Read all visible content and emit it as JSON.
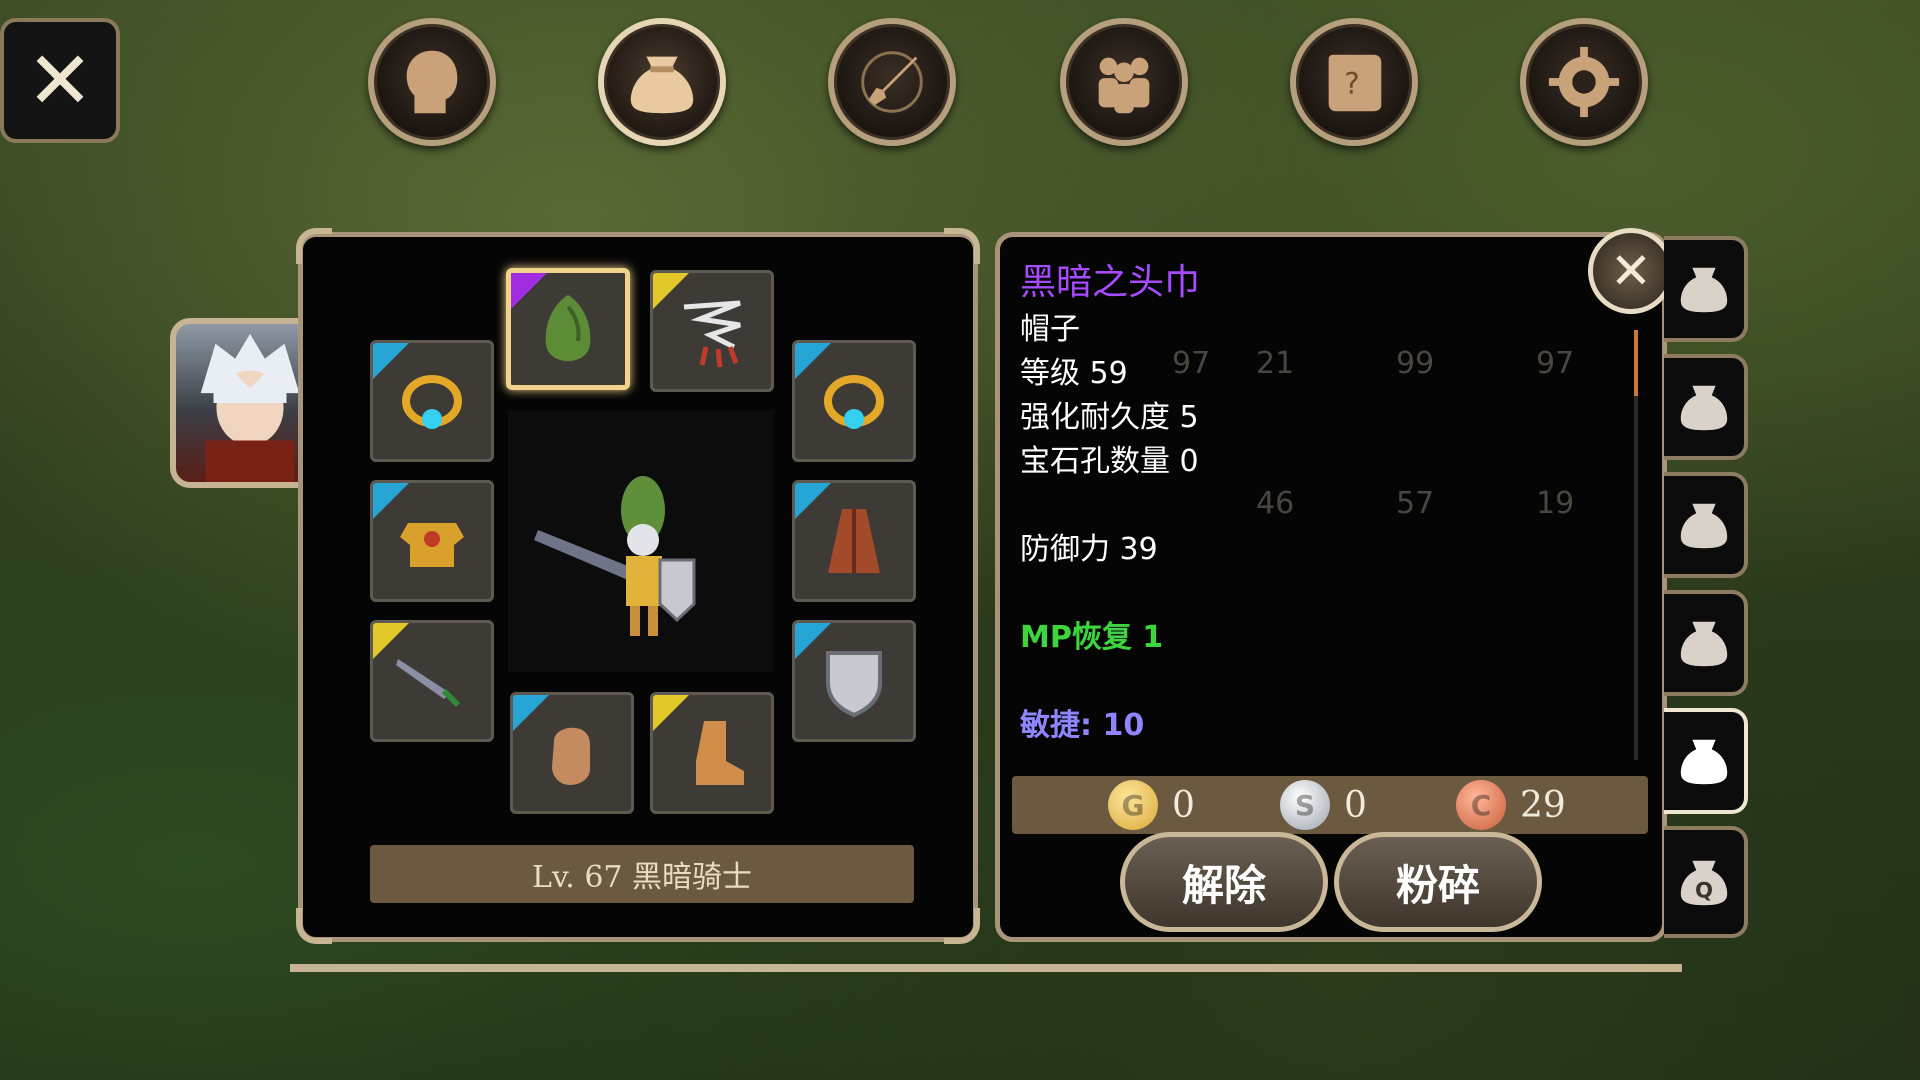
{
  "top_bar": {
    "close_label": "✕",
    "buttons": [
      {
        "icon": "head-silhouette-icon",
        "active": false
      },
      {
        "icon": "bag-icon",
        "active": true
      },
      {
        "icon": "sword-compass-icon",
        "active": false
      },
      {
        "icon": "party-icon",
        "active": false
      },
      {
        "icon": "quest-scroll-icon",
        "active": false
      },
      {
        "icon": "gear-icon",
        "active": false
      }
    ]
  },
  "equipment": {
    "character_name": "Lv. 67 黑暗骑士",
    "slots": [
      {
        "id": "helmet",
        "icon": "green-hood-icon",
        "rarity": "purple",
        "selected": true
      },
      {
        "id": "necklace",
        "icon": "claw-necklace-icon",
        "rarity": "yellow"
      },
      {
        "id": "ring-left",
        "icon": "gold-ring-icon",
        "rarity": "blue"
      },
      {
        "id": "ring-right",
        "icon": "gold-ring-icon",
        "rarity": "blue"
      },
      {
        "id": "armor",
        "icon": "gold-armor-icon",
        "rarity": "blue"
      },
      {
        "id": "cloak",
        "icon": "cloak-icon",
        "rarity": "blue"
      },
      {
        "id": "weapon",
        "icon": "sword-icon",
        "rarity": "yellow"
      },
      {
        "id": "shield",
        "icon": "shield-icon",
        "rarity": "blue"
      },
      {
        "id": "gloves",
        "icon": "glove-icon",
        "rarity": "blue"
      },
      {
        "id": "boots",
        "icon": "boot-icon",
        "rarity": "yellow"
      }
    ]
  },
  "detail": {
    "item_name": "黑暗之头巾",
    "type": "帽子",
    "level": "等级 59",
    "durability": "强化耐久度 5",
    "sockets": "宝石孔数量 0",
    "defense": "防御力 39",
    "bonus_mp": "MP恢复 1",
    "bonus_agility": "敏捷: 10",
    "colors": {
      "name": "#a64bff",
      "mp": "#3ed43e",
      "agility": "#8f86ff"
    },
    "currency": {
      "gold": "0",
      "silver": "0",
      "copper": "29"
    },
    "buttons": {
      "unequip": "解除",
      "smash": "粉碎"
    },
    "background_counts": [
      "97",
      "21",
      "99",
      "97",
      "46",
      "57",
      "19"
    ]
  },
  "side_tabs": [
    {
      "icon": "bag-icon",
      "active": false
    },
    {
      "icon": "bag-icon",
      "active": false
    },
    {
      "icon": "bag-icon",
      "active": false
    },
    {
      "icon": "bag-icon",
      "active": false
    },
    {
      "icon": "bag-icon",
      "active": true
    },
    {
      "icon": "quest-bag-icon",
      "active": false
    }
  ]
}
